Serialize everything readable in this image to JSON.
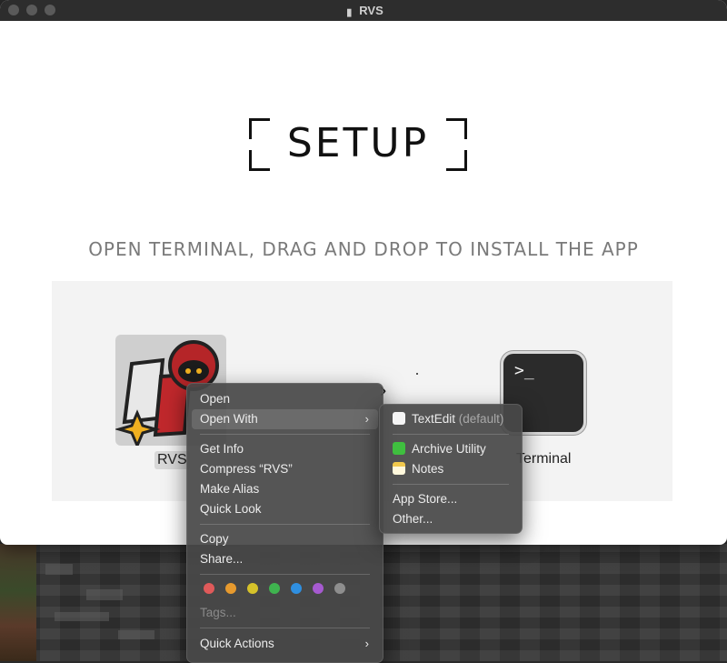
{
  "window": {
    "title": "RVS"
  },
  "content": {
    "setup_title": "SETUP",
    "instruction": "OPEN TERMINAL, DRAG AND DROP TO INSTALL THE APP",
    "app_label": "RVS",
    "terminal_label": "Terminal",
    "terminal_prompt": ">_"
  },
  "context_menu": {
    "open": "Open",
    "open_with": "Open With",
    "get_info": "Get Info",
    "compress": "Compress “RVS”",
    "make_alias": "Make Alias",
    "quick_look": "Quick Look",
    "copy": "Copy",
    "share": "Share...",
    "tags": "Tags...",
    "quick_actions": "Quick Actions",
    "tag_colors": [
      "#e05a5a",
      "#e79a2e",
      "#d6c22a",
      "#3fb34f",
      "#2f8fe0",
      "#a65ad0",
      "#8e8e8e"
    ]
  },
  "open_with_submenu": {
    "textedit": "TextEdit",
    "textedit_suffix": "(default)",
    "archive_utility": "Archive Utility",
    "notes": "Notes",
    "app_store": "App Store...",
    "other": "Other..."
  }
}
